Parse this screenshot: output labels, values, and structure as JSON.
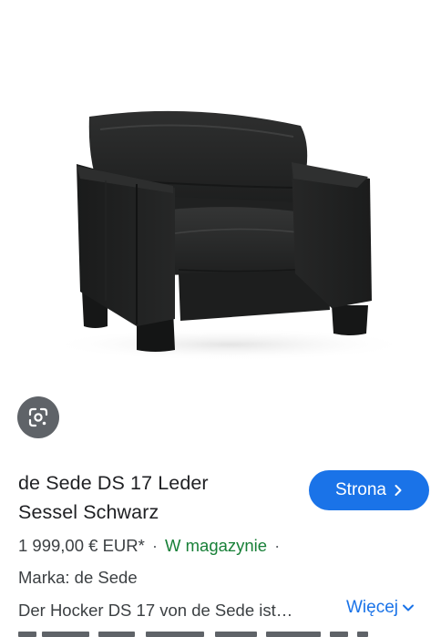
{
  "product": {
    "title_line1": "de Sede DS 17 Leder",
    "title_line2": "Sessel Schwarz",
    "price": "1 999,00 € EUR*",
    "separator": "·",
    "stock_status": "W magazynie",
    "brand": "Marka: de Sede",
    "description": "Der Hocker DS 17 von de Sede ist…"
  },
  "actions": {
    "visit_label": "Strona",
    "more_label": "Więcej"
  },
  "icons": {
    "lens": "google-lens-icon",
    "visit_chevron": "chevron-right-icon",
    "more_chevron": "chevron-down-icon"
  },
  "colors": {
    "accent": "#1a73e8",
    "stock_green": "#188038",
    "text": "#202124",
    "secondary_text": "#3c4043",
    "lens_button_bg": "#5f6368"
  }
}
